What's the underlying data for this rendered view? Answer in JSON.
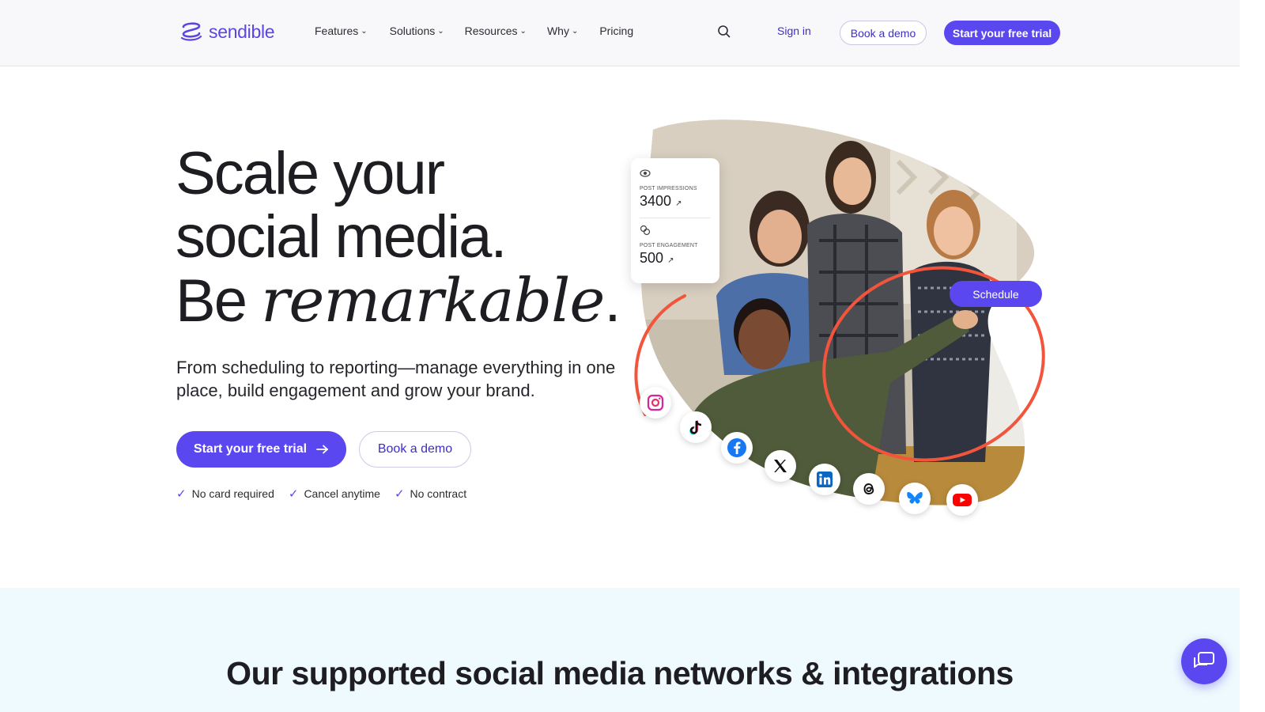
{
  "header": {
    "logo_text": "sendible",
    "nav": [
      {
        "label": "Features",
        "has_dropdown": true
      },
      {
        "label": "Solutions",
        "has_dropdown": true
      },
      {
        "label": "Resources",
        "has_dropdown": true
      },
      {
        "label": "Why",
        "has_dropdown": true
      },
      {
        "label": "Pricing",
        "has_dropdown": false
      }
    ],
    "search_icon": "search-icon",
    "sign_in": "Sign in",
    "book_demo": "Book a demo",
    "start_trial": "Start your free trial"
  },
  "hero": {
    "title_line1": "Scale your",
    "title_line2": "social media.",
    "title_line3_plain": "Be ",
    "title_line3_em": "remarkable",
    "title_line3_end": ".",
    "subtitle": "From scheduling to reporting—manage everything in one place, build engagement and grow your brand.",
    "cta_trial": "Start your free trial",
    "cta_demo": "Book a demo",
    "perks": [
      "No card required",
      "Cancel anytime",
      "No contract"
    ]
  },
  "stats_card": {
    "impressions_label": "POST IMPRESSIONS",
    "impressions_value": "3400",
    "engagement_label": "POST ENGAGEMENT",
    "engagement_value": "500"
  },
  "schedule_label": "Schedule",
  "social_icons": [
    "instagram-icon",
    "tiktok-icon",
    "facebook-icon",
    "x-icon",
    "linkedin-icon",
    "threads-icon",
    "bluesky-icon",
    "youtube-icon"
  ],
  "colors": {
    "brand": "#5b47f0",
    "accent_red": "#f2553c",
    "band_bg": "#eefafd"
  },
  "band": {
    "title": "Our supported social media networks & integrations"
  },
  "chat_icon": "chat-icon"
}
